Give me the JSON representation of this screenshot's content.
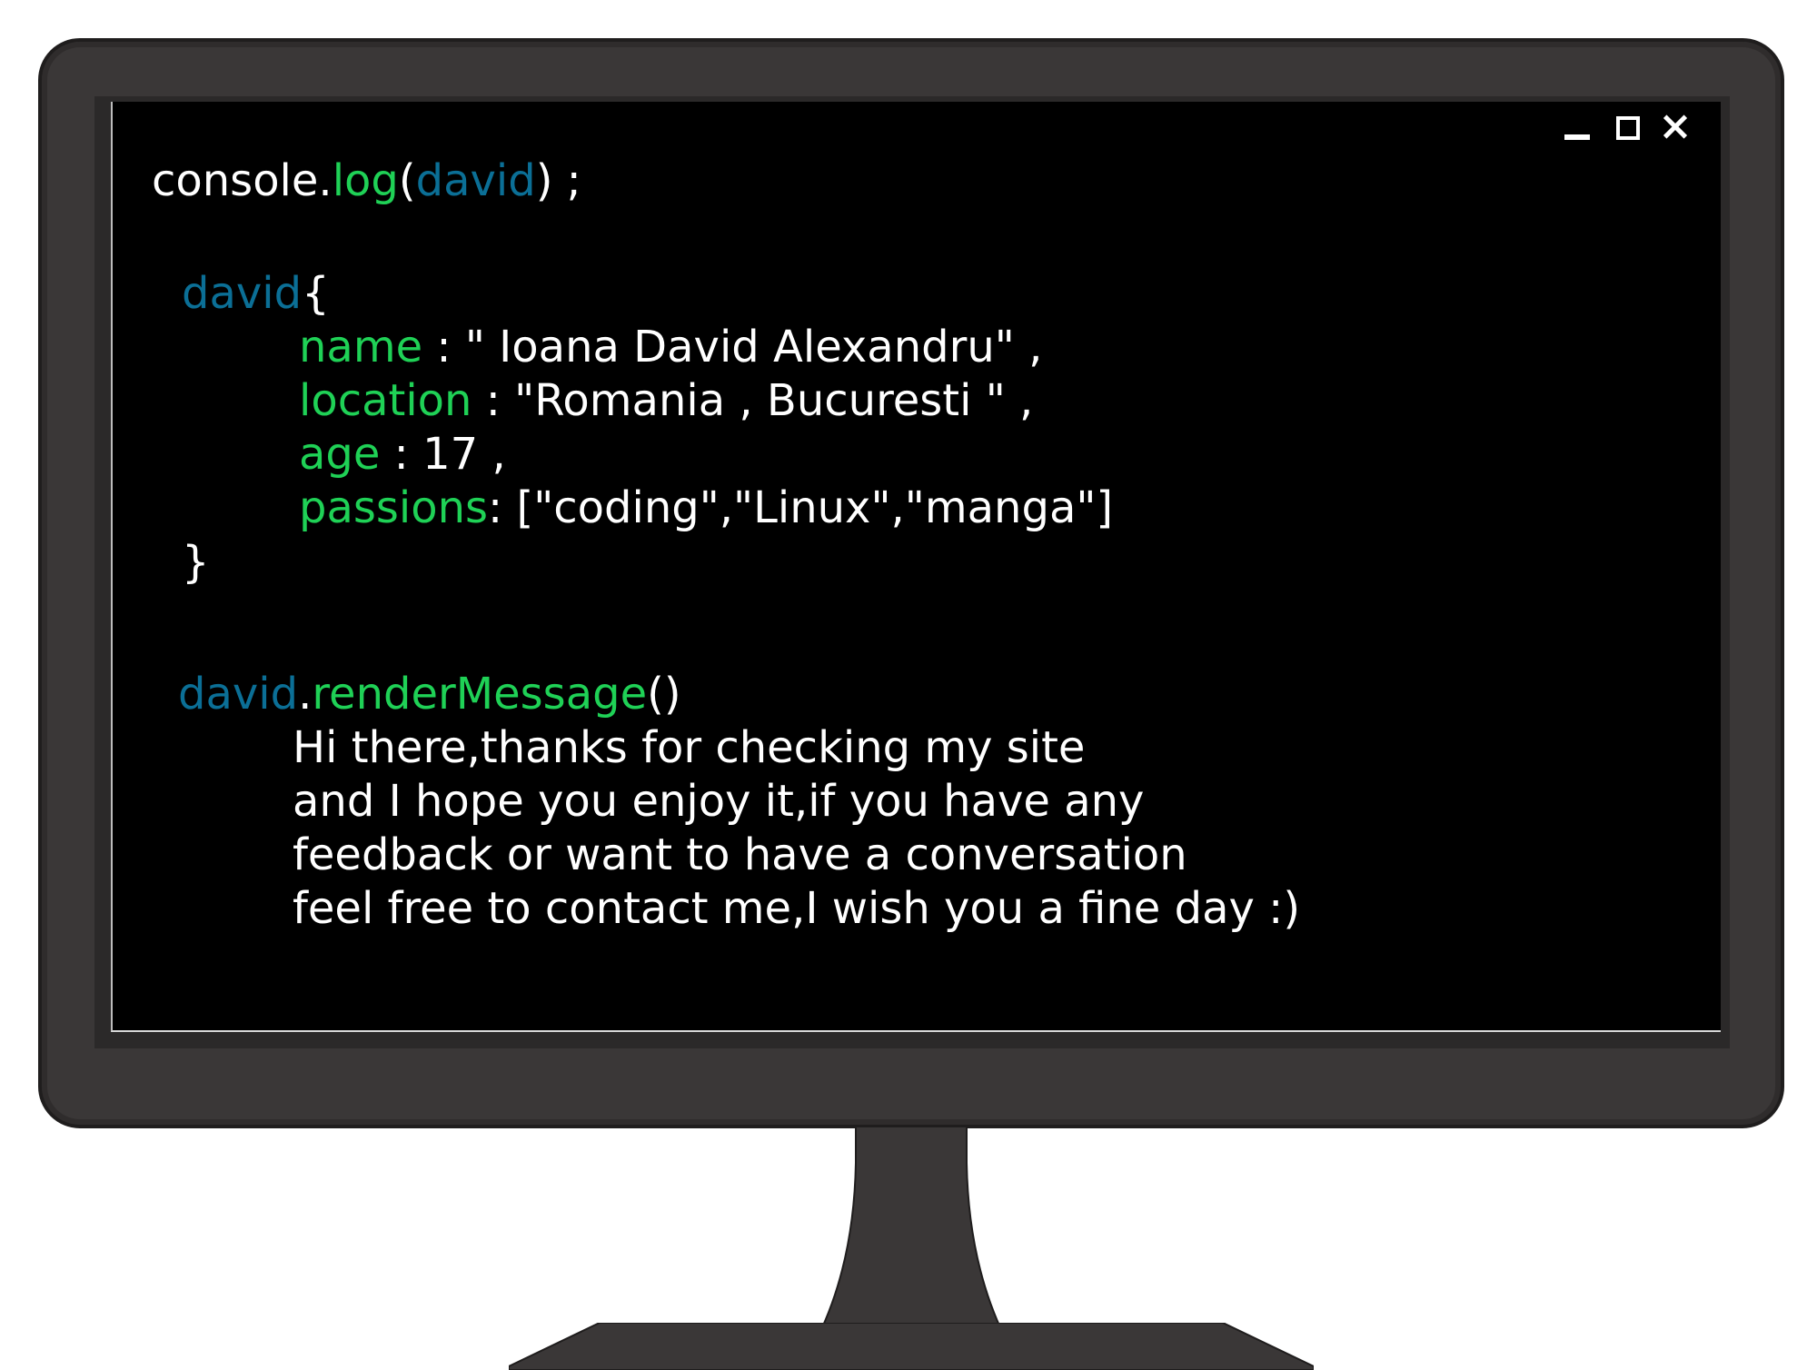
{
  "window_controls": {
    "minimize_icon": "minimize-icon",
    "maximize_icon": "maximize-icon",
    "close_icon": "close-icon"
  },
  "code": {
    "line1": {
      "obj": "console",
      "dot": ".",
      "method": "log",
      "open": "(",
      "arg": "david",
      "close": ") ;"
    },
    "object_name": "david",
    "open_brace": "{",
    "props": [
      {
        "key": "name",
        "rest": " : \" Ioana David Alexandru\" ,"
      },
      {
        "key": "location",
        "rest": " : \"Romania , Bucuresti \" ,"
      },
      {
        "key": "age",
        "rest": " : 17 ,"
      },
      {
        "key": "passions",
        "rest": ": [\"coding\",\"Linux\",\"manga\"]"
      }
    ],
    "close_brace": "}",
    "render": {
      "obj": "david",
      "dot": ".",
      "method": "renderMessage",
      "parens": "()"
    },
    "message_lines": [
      "Hi there,thanks for checking my site",
      "and I hope you enjoy it,if you have any",
      "feedback or want to have a conversation",
      "feel free to contact me,I wish you a fine day :)"
    ]
  },
  "colors": {
    "background": "#000000",
    "text": "#ffffff",
    "keyword_green": "#1fd156",
    "identifier_blue": "#0b6f96",
    "bezel": "#3a3737"
  }
}
